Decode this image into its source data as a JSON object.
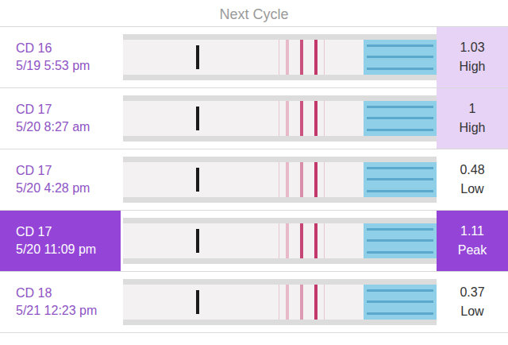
{
  "header": {
    "title": "Next Cycle"
  },
  "rows": [
    {
      "day": "CD 16",
      "datetime": "5/19 5:53 pm",
      "value": "1.03",
      "result": "High",
      "kind": "high",
      "selected": false
    },
    {
      "day": "CD 17",
      "datetime": "5/20 8:27 am",
      "value": "1",
      "result": "High",
      "kind": "high",
      "selected": false
    },
    {
      "day": "CD 17",
      "datetime": "5/20 4:28 pm",
      "value": "0.48",
      "result": "Low",
      "kind": "low",
      "selected": false
    },
    {
      "day": "CD 17",
      "datetime": "5/20 11:09 pm",
      "value": "1.11",
      "result": "Peak",
      "kind": "peak",
      "selected": true
    },
    {
      "day": "CD 18",
      "datetime": "5/21 12:23 pm",
      "value": "0.37",
      "result": "Low",
      "kind": "low",
      "selected": false
    }
  ]
}
